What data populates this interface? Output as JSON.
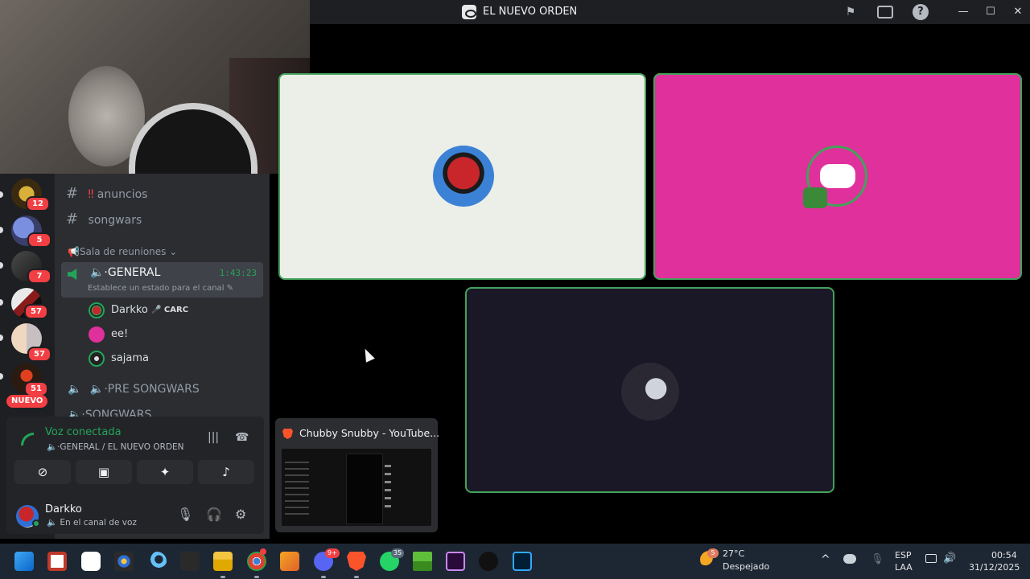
{
  "window": {
    "title": "EL NUEVO ORDEN",
    "controls": {
      "minimize": "—",
      "maximize": "☐",
      "close": "✕"
    }
  },
  "server_rail": {
    "badges": [
      "12",
      "5",
      "7",
      "57",
      "57",
      "51"
    ],
    "new_label": "NUEVO"
  },
  "channels": {
    "text": [
      {
        "prefix": "‼",
        "name": "anuncios"
      },
      {
        "prefix": "",
        "name": "songwars"
      }
    ],
    "category": "📢Sala de reuniones ⌄",
    "active_voice": {
      "name": "🔈·GENERAL",
      "timer": "1:43:23",
      "status": "Establece un estado para el canal ✎",
      "members": [
        {
          "name": "Darkko",
          "tag": "🎤 CARC"
        },
        {
          "name": "ee!",
          "tag": ""
        },
        {
          "name": "sajama",
          "tag": ""
        }
      ]
    },
    "other_voice": [
      {
        "name": "🔈·PRE SONGWARS"
      },
      {
        "name": "🔈·SONGWARS"
      }
    ]
  },
  "voice_panel": {
    "title": "Voz conectada",
    "subtitle": "🔈·GENERAL / EL NUEVO ORDEN",
    "buttons": [
      "camera-off",
      "screen-share",
      "activities",
      "soundboard"
    ],
    "user": {
      "name": "Darkko",
      "status": "🔈 En el canal de voz"
    }
  },
  "preview": {
    "title": "Chubby Snubby - YouTube..."
  },
  "taskbar": {
    "weather": {
      "temp": "27°C",
      "desc": "Despejado",
      "alert": "5"
    },
    "lang": {
      "line1": "ESP",
      "line2": "LAA"
    },
    "time": "00:54",
    "date": "31/12/2025",
    "app_badges": {
      "discord": "9+",
      "whatsapp": "35"
    },
    "apps": [
      "windows-start",
      "start-menu-app",
      "capcut",
      "davinci-resolve",
      "steam",
      "epic-games",
      "file-explorer",
      "chrome",
      "fl-studio",
      "discord",
      "brave",
      "whatsapp",
      "minecraft",
      "premiere-pro",
      "tiktok",
      "photoshop"
    ]
  },
  "colors": {
    "speaking_border": "#43a25a",
    "discord_green": "#23a559",
    "pink_tile": "#e0309c",
    "badge_red": "#f23f43"
  }
}
